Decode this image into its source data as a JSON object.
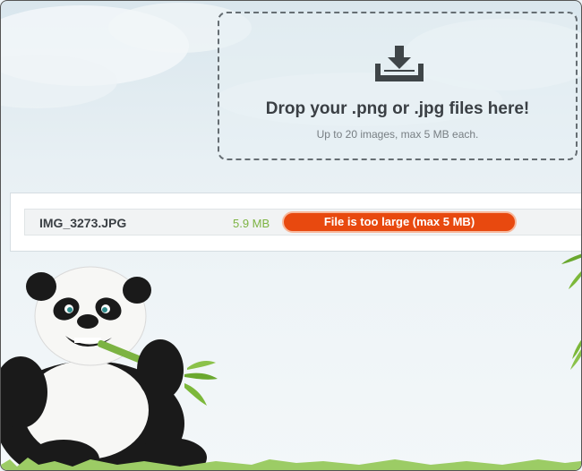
{
  "dropzone": {
    "icon": "download-tray-icon",
    "title": "Drop your .png or .jpg files here!",
    "subtitle": "Up to 20 images, max 5 MB each."
  },
  "files": [
    {
      "name": "IMG_3273.JPG",
      "size": "5.9 MB",
      "status": "File is too large (max 5 MB)",
      "status_color": "#e8490f",
      "size_color": "#7cb342"
    }
  ],
  "mascot": {
    "icon": "panda-mascot-icon"
  }
}
